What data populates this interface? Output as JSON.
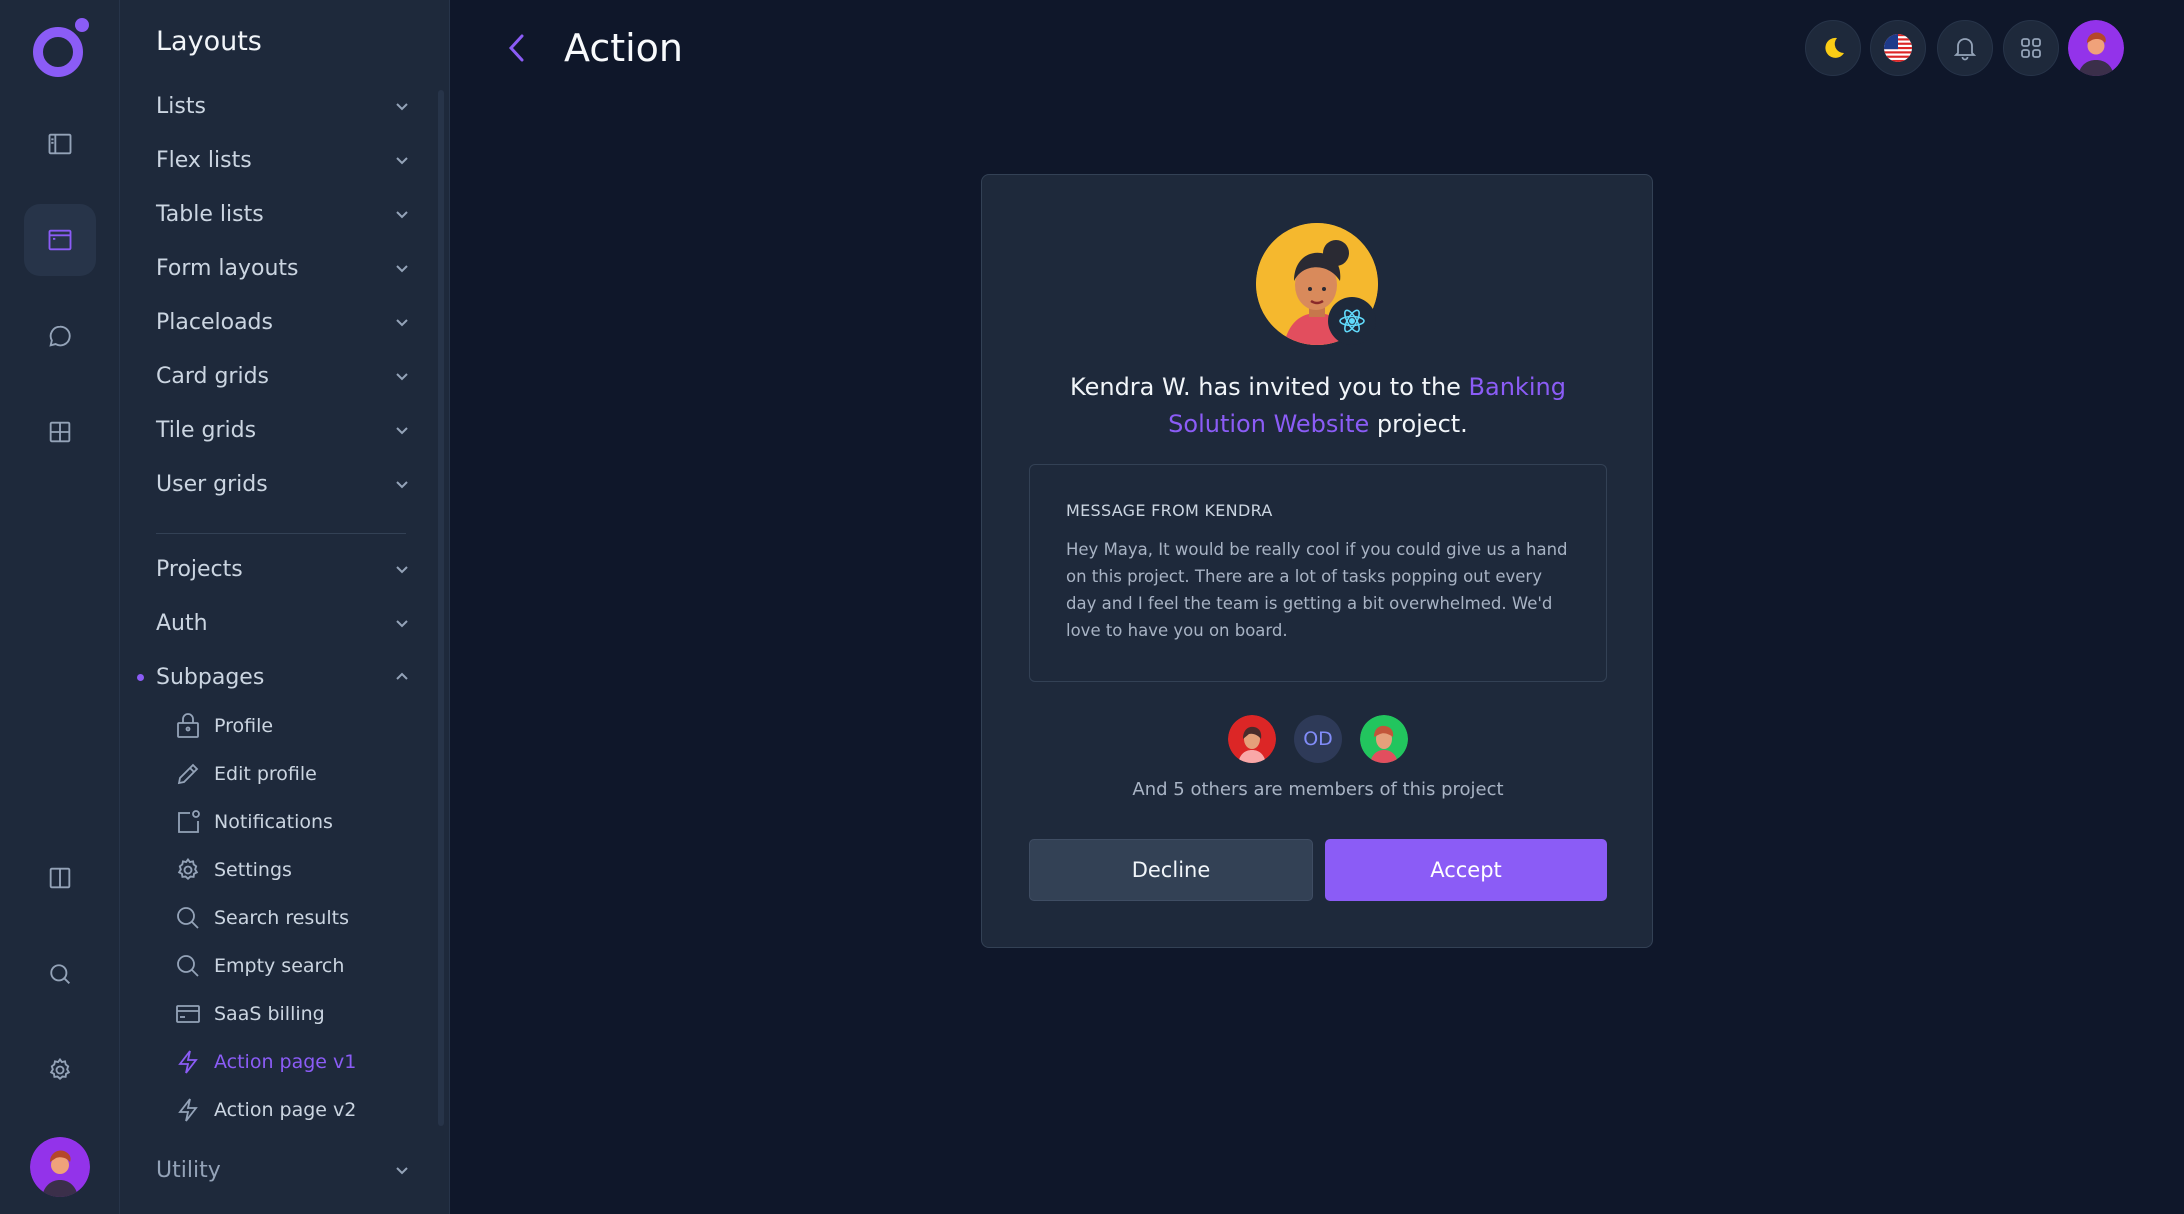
{
  "colors": {
    "accent": "#8b5cf6",
    "background": "#0f172a",
    "panel": "#1e293b"
  },
  "rail": {
    "items": [
      {
        "icon": "sidebar-icon"
      },
      {
        "icon": "browser-window-icon",
        "active": true
      },
      {
        "icon": "chat-bubble-icon"
      },
      {
        "icon": "grid-icon"
      },
      {
        "icon": "columns-icon"
      },
      {
        "icon": "search-icon"
      },
      {
        "icon": "gear-icon"
      }
    ]
  },
  "subnav": {
    "title": "Layouts",
    "groups": [
      {
        "label": "Lists"
      },
      {
        "label": "Flex lists"
      },
      {
        "label": "Table lists"
      },
      {
        "label": "Form layouts"
      },
      {
        "label": "Placeloads"
      },
      {
        "label": "Card grids"
      },
      {
        "label": "Tile grids"
      },
      {
        "label": "User grids"
      },
      {
        "label": "Projects"
      },
      {
        "label": "Auth"
      },
      {
        "label": "Subpages",
        "expanded": true
      },
      {
        "label": "Utility"
      }
    ],
    "subpages": [
      {
        "label": "Profile",
        "icon": "lock-icon"
      },
      {
        "label": "Edit profile",
        "icon": "pencil-icon"
      },
      {
        "label": "Notifications",
        "icon": "notification-icon"
      },
      {
        "label": "Settings",
        "icon": "gear-icon"
      },
      {
        "label": "Search results",
        "icon": "search-icon"
      },
      {
        "label": "Empty search",
        "icon": "search-icon"
      },
      {
        "label": "SaaS billing",
        "icon": "credit-card-icon"
      },
      {
        "label": "Action page v1",
        "icon": "lightning-icon",
        "active": true
      },
      {
        "label": "Action page v2",
        "icon": "lightning-icon"
      }
    ]
  },
  "header": {
    "title": "Action",
    "buttons": [
      "moon-icon",
      "us-flag-icon",
      "bell-icon",
      "apps-grid-icon"
    ]
  },
  "card": {
    "invite_prefix": "Kendra W. has invited you to the ",
    "project_name": "Banking Solution Website",
    "invite_suffix": " project.",
    "message_title": "MESSAGE FROM KENDRA",
    "message_body": "Hey Maya, It would be really cool if you could give us a hand on this project. There are a lot of tasks popping out every day and I feel the team is getting a bit overwhelmed. We'd love to have you on board.",
    "member_initials": "OD",
    "members_note": "And 5 others are members of this project",
    "decline_label": "Decline",
    "accept_label": "Accept"
  }
}
